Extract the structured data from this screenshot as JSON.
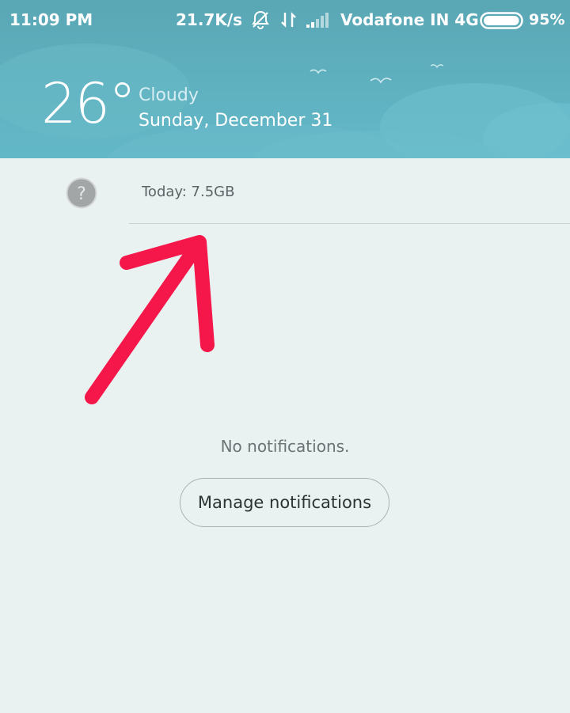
{
  "status_bar": {
    "time": "11:09 PM",
    "network_speed": "21.7K/s",
    "carrier": "Vodafone IN 4G",
    "battery_percent": "95%",
    "battery_level": 0.95,
    "icons": [
      "bell-off-icon",
      "data-transfer-icon",
      "signal-icon",
      "battery-icon"
    ]
  },
  "weather": {
    "temperature": "26°",
    "condition": "Cloudy",
    "date": "Sunday, December 31"
  },
  "notification_panel": {
    "help_icon_glyph": "?",
    "data_usage": "Today: 7.5GB",
    "empty_message": "No notifications.",
    "manage_button_label": "Manage notifications"
  },
  "colors": {
    "header": "#5fb1c0",
    "panel_background": "#e9f1f1",
    "annotation_arrow": "#f5174a"
  }
}
